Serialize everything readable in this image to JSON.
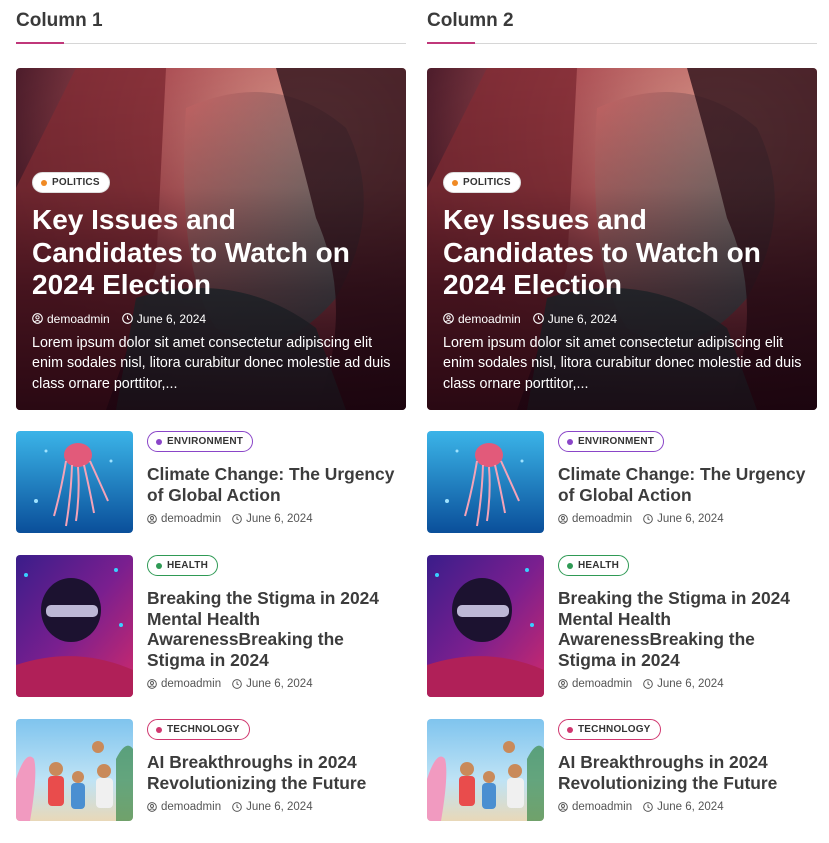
{
  "columns": [
    {
      "heading": "Column 1",
      "hero": {
        "tag": "POLITICS",
        "title": "Key Issues and Candidates to Watch on 2024 Election",
        "author": "demoadmin",
        "date": "June 6, 2024",
        "excerpt": "Lorem ipsum dolor sit amet consectetur adipiscing elit enim sodales nisl, litora curabitur donec molestie ad duis class ornare porttitor,..."
      },
      "posts": [
        {
          "tag": "ENVIRONMENT",
          "title": "Climate Change: The Urgency of Global Action",
          "author": "demoadmin",
          "date": "June 6, 2024"
        },
        {
          "tag": "HEALTH",
          "title": "Breaking the Stigma in 2024 Mental Health AwarenessBreaking the Stigma in 2024",
          "author": "demoadmin",
          "date": "June 6, 2024"
        },
        {
          "tag": "TECHNOLOGY",
          "title": "AI Breakthroughs in 2024 Revolutionizing the Future",
          "author": "demoadmin",
          "date": "June 6, 2024"
        }
      ]
    },
    {
      "heading": "Column 2",
      "hero": {
        "tag": "POLITICS",
        "title": "Key Issues and Candidates to Watch on 2024 Election",
        "author": "demoadmin",
        "date": "June 6, 2024",
        "excerpt": "Lorem ipsum dolor sit amet consectetur adipiscing elit enim sodales nisl, litora curabitur donec molestie ad duis class ornare porttitor,..."
      },
      "posts": [
        {
          "tag": "ENVIRONMENT",
          "title": "Climate Change: The Urgency of Global Action",
          "author": "demoadmin",
          "date": "June 6, 2024"
        },
        {
          "tag": "HEALTH",
          "title": "Breaking the Stigma in 2024 Mental Health AwarenessBreaking the Stigma in 2024",
          "author": "demoadmin",
          "date": "June 6, 2024"
        },
        {
          "tag": "TECHNOLOGY",
          "title": "AI Breakthroughs in 2024 Revolutionizing the Future",
          "author": "demoadmin",
          "date": "June 6, 2024"
        }
      ]
    }
  ],
  "colors": {
    "accent": "#c0377a",
    "politics": "#f08a24",
    "environment": "#8a45c8",
    "health": "#2f9a55",
    "technology": "#d0376f"
  },
  "icons": {
    "author": "user-circle-icon",
    "date": "clock-icon"
  }
}
